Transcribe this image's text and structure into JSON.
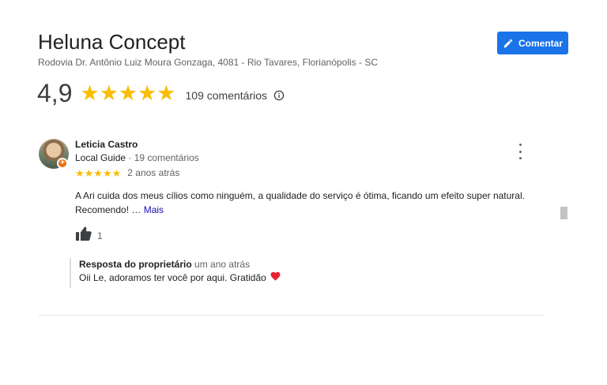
{
  "place": {
    "title": "Heluna Concept",
    "address": "Rodovia Dr. Antônio Luiz Moura Gonzaga, 4081 - Rio Tavares, Florianópolis - SC"
  },
  "actions": {
    "comment_label": "Comentar",
    "comment_icon": "pencil-icon"
  },
  "rating": {
    "value": "4,9",
    "stars": 5,
    "stars_text": "★★★★★",
    "count_text": "109 comentários",
    "info_icon": "info-icon"
  },
  "review": {
    "reviewer_name": "Leticia Castro",
    "guide_label": "Local Guide",
    "meta_sep": " · ",
    "reviewer_count": "19 comentários",
    "stars": 5,
    "stars_text": "★★★★★",
    "date": "2 anos atrás",
    "text": "A Ari cuida dos meus cílios como ninguém, a qualidade do serviço é ótima, ficando um efeito super natural. Recomendo! …",
    "more_label": "Mais",
    "likes": "1"
  },
  "reply": {
    "owner_label": "Resposta do proprietário",
    "date": "um ano atrás",
    "text": "Oii Le, adoramos ter você por aqui. Gratidão"
  },
  "colors": {
    "accent": "#1a73e8",
    "star": "#fbbc04",
    "heart": "#e52535"
  }
}
